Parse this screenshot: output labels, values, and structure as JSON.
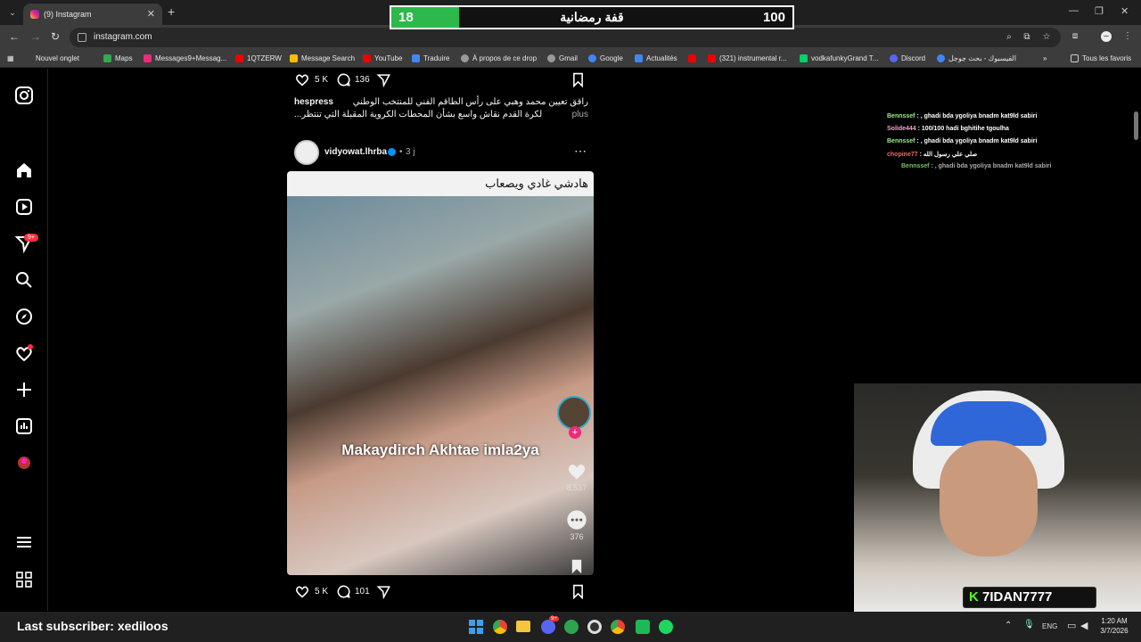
{
  "browser": {
    "tab_title": "(9) Instagram",
    "url": "instagram.com",
    "bookmarks": [
      "Nouvel onglet",
      "Maps",
      "Messages9+Messag...",
      "1QTZERW",
      "Message Search",
      "YouTube",
      "Traduire",
      "À propos de ce drop",
      "Gmail",
      "Google",
      "Actualités",
      "(321) instrumental r...",
      "vodkafunkyGrand T...",
      "Discord",
      "الفيسبوك - بحث جوجل"
    ],
    "bookmarks_all": "Tous les favoris"
  },
  "overlay": {
    "left_number": "18",
    "title": "قفة رمضانية",
    "right_number": "100"
  },
  "sidebar": {
    "notifications_badge": "9+"
  },
  "post1": {
    "likes": "5 K",
    "comments": "136",
    "author": "hespress",
    "caption_line1": "راقق تعيين محمد وهبي على رأس الطاقم الفني للمنتخب الوطني",
    "caption_line2": "لكرة القدم نقاش واسع بشأن المحطات الكروية المقبلة التي تنتظر...",
    "more": "plus"
  },
  "post2": {
    "author": "vidyowat.lhrba",
    "time": "3 j",
    "media_title": "هادشي غادي ويصعاب",
    "overlay_text": "Makaydirch Akhtae imla2ya",
    "reel_likes": "8,537",
    "reel_comments": "376",
    "likes": "5 K",
    "comments": "101"
  },
  "chat": [
    {
      "user": "Bennssef",
      "msg": ": , ghadi bda ygoliya bnadm kat9ld sabiri",
      "color": "#9cf08a"
    },
    {
      "user": "Solide444",
      "msg": ": 100/100 hadi bghitihe tgoulha",
      "color": "#f0a6c8"
    },
    {
      "user": "Bennssef",
      "msg": ": , ghadi bda ygoliya bnadm kat9ld sabiri",
      "color": "#9cf08a"
    },
    {
      "user": "chopine77",
      "msg": ": صلي علي رسول الله",
      "color": "#f06a6a"
    },
    {
      "user": "Bennssef",
      "msg": ": , ghadi bda ygoliya bnadm kat9ld sabiri",
      "color": "#7ac06a"
    }
  ],
  "stream": {
    "last_subscriber": "Last subscriber: xediloos",
    "streamer_name": "7IDAN7777"
  },
  "taskbar": {
    "lang": "ENG",
    "time": "1:20 AM",
    "date": "3/7/2026",
    "discord_badge": "9+"
  }
}
